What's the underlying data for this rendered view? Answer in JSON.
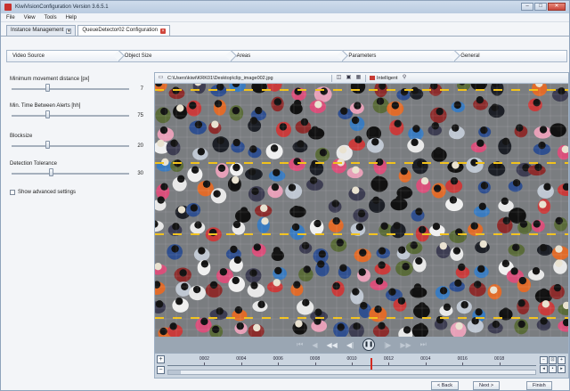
{
  "window": {
    "title": "KiwiVisionConfiguration Version 3.6.5.1"
  },
  "menu": [
    "File",
    "View",
    "Tools",
    "Help"
  ],
  "doc_tabs": [
    {
      "label": "Instance Management",
      "active": false
    },
    {
      "label": "QueueDetector02 Configuration",
      "active": true
    }
  ],
  "wizard_steps": [
    "Video Source",
    "Object Size",
    "Areas",
    "Parameters",
    "General"
  ],
  "settings": [
    {
      "label": "Minimum movement distance [px]",
      "value": "7",
      "level": 0.3
    },
    {
      "label": "Min. Time Between Alerts [hh]",
      "value": "75",
      "level": 0.3
    },
    {
      "label": "Blocksize",
      "value": "20",
      "level": 0.3
    },
    {
      "label": "Detection Tolerance",
      "value": "30",
      "level": 0.33
    }
  ],
  "advanced_settings_label": "Show advanced settings",
  "viewer": {
    "path": "C:\\Users\\kiwi\\KRK01\\Desktop\\clip_image002.jpg",
    "intelligent_label": "Intelligent"
  },
  "timeline": {
    "labels": [
      "0002",
      "0004",
      "0006",
      "0008",
      "0010",
      "0012",
      "0014",
      "0016",
      "0018"
    ],
    "cursor_index": 4.5
  },
  "footer": {
    "back_label": "< Back",
    "next_label": "Next >",
    "finish_label": "Finish"
  },
  "colors": {
    "accent_red": "#c8322e",
    "lane_yellow": "#f2c21b"
  }
}
